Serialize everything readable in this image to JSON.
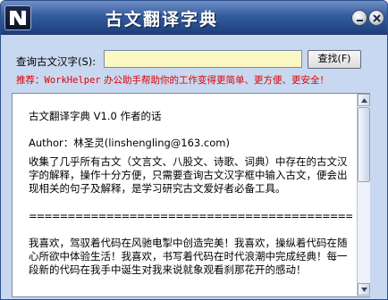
{
  "window": {
    "title": "古文翻译字典"
  },
  "search": {
    "label": "查询古文汉字(S):",
    "value": "",
    "button_label": "查找(F)"
  },
  "promo": {
    "prefix": "推荐：",
    "brand": "WorkHelper",
    "text": " 办公助手帮助你的工作变得更简单、更方便、更安全！"
  },
  "content": {
    "title": "古文翻译字典 V1.0 作者的话",
    "author": "Author：林圣灵(linshengling@163.com)",
    "intro": "收集了几乎所有古文（文言文、八股文、诗歌、词典）中存在的古文汉字的解释，操作十分方便，只需要查询古文汉字框中输入古文，便会出现相关的句子及解释，是学习研究古文爱好者必备工具。",
    "divider": "=============================================",
    "closing": "我喜欢，驾驭着代码在风驰电掣中创造完美！我喜欢，操纵着代码在随心所欲中体验生活！我喜欢，书写着代码在时代浪潮中完成经典！每一段新的代码在我手中诞生对我来说就象观看刹那花开的感动！"
  },
  "colors": {
    "titlebar": "#345c9e",
    "window_bg": "#c8d8f0",
    "input_bg": "#fcf8c4",
    "promo_text": "#e00000"
  },
  "icons": {
    "logo": "app-logo-icon",
    "minimize": "minimize-icon",
    "close": "close-icon",
    "scroll_up": "arrow-up-icon",
    "scroll_down": "arrow-down-icon"
  }
}
